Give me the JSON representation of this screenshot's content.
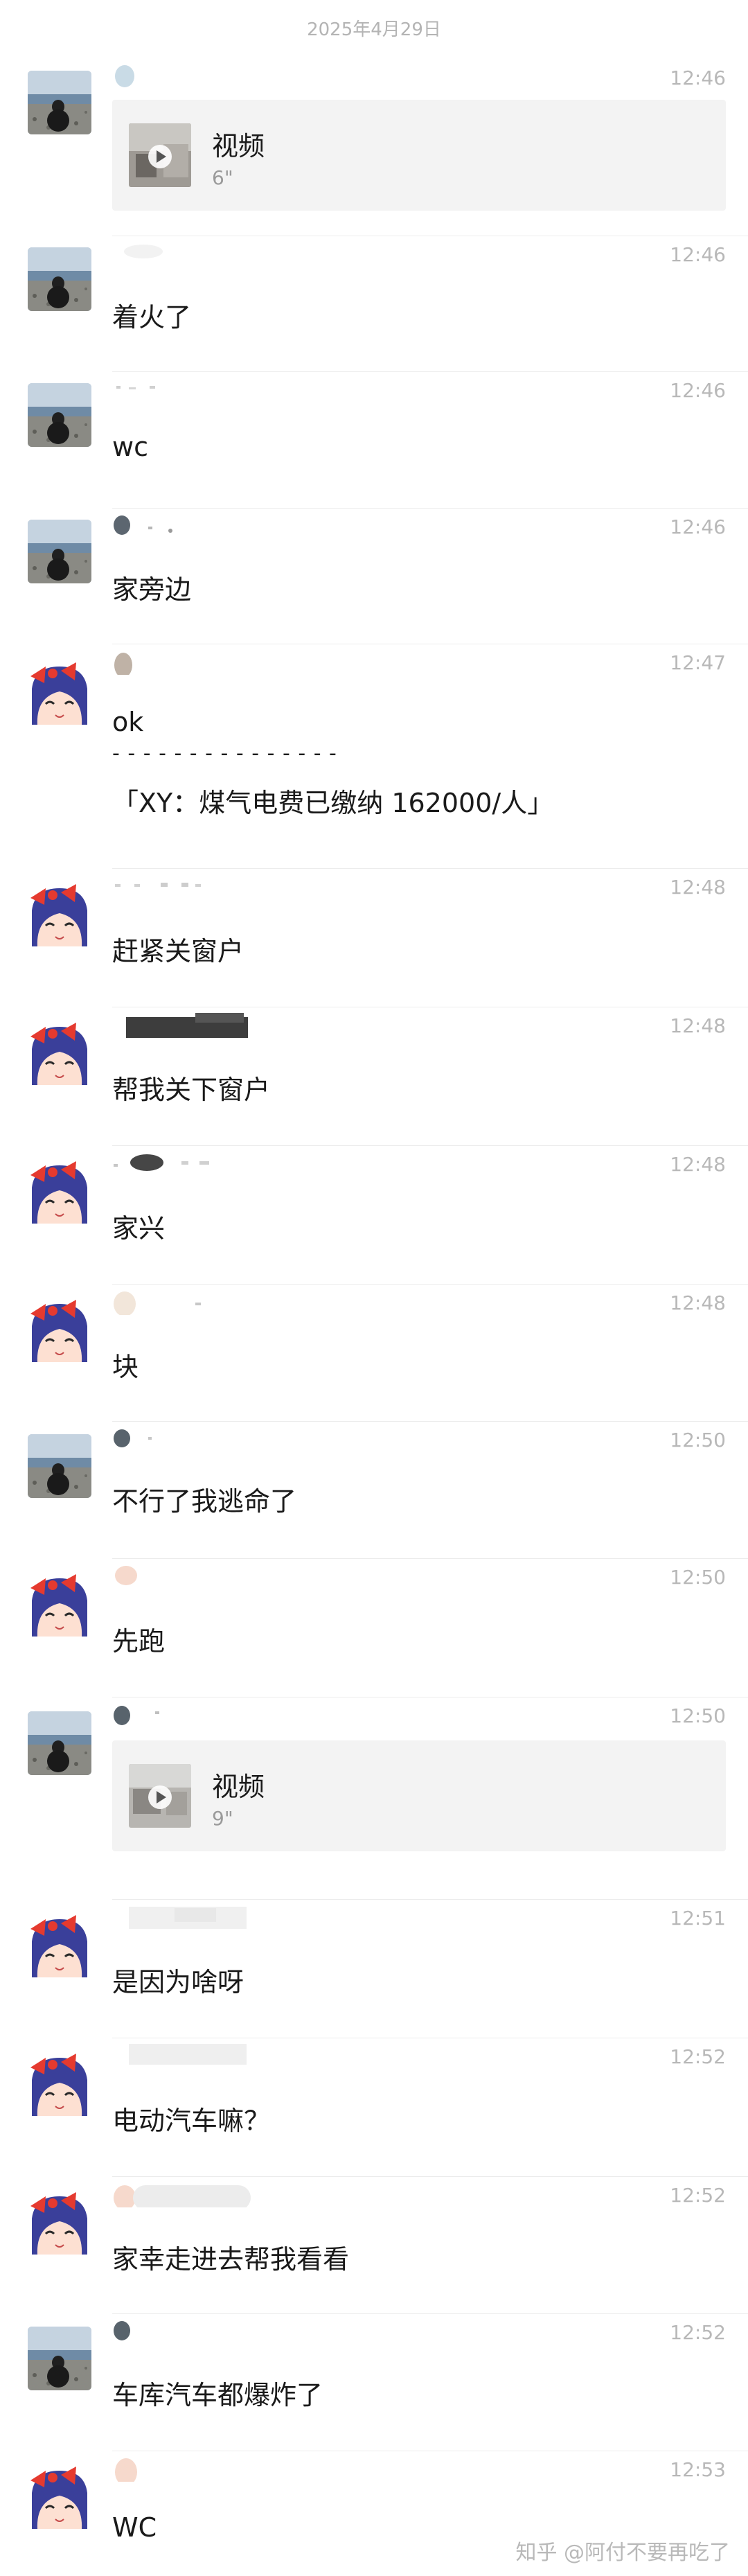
{
  "date_header": "2025年4月29日",
  "messages": [
    {
      "avatar": "beach",
      "time": "12:46",
      "type": "video",
      "video": {
        "title": "视频",
        "duration": "6\""
      }
    },
    {
      "avatar": "beach",
      "time": "12:46",
      "type": "text",
      "text": "着火了"
    },
    {
      "avatar": "beach",
      "time": "12:46",
      "type": "text",
      "text": "wc"
    },
    {
      "avatar": "beach",
      "time": "12:46",
      "type": "text",
      "text": "家旁边"
    },
    {
      "avatar": "anime",
      "time": "12:47",
      "type": "text",
      "text": "ok",
      "quote_divider": "- - - - - - - - - - - - - - -",
      "quote": "「XY：煤气电费已缴纳 162000/人」"
    },
    {
      "avatar": "anime",
      "time": "12:48",
      "type": "text",
      "text": "赶紧关窗户"
    },
    {
      "avatar": "anime",
      "time": "12:48",
      "type": "text",
      "text": "帮我关下窗户"
    },
    {
      "avatar": "anime",
      "time": "12:48",
      "type": "text",
      "text": "家兴"
    },
    {
      "avatar": "anime",
      "time": "12:48",
      "type": "text",
      "text": "块"
    },
    {
      "avatar": "beach",
      "time": "12:50",
      "type": "text",
      "text": "不行了我逃命了"
    },
    {
      "avatar": "anime",
      "time": "12:50",
      "type": "text",
      "text": "先跑"
    },
    {
      "avatar": "beach",
      "time": "12:50",
      "type": "video",
      "video": {
        "title": "视频",
        "duration": "9\""
      }
    },
    {
      "avatar": "anime",
      "time": "12:51",
      "type": "text",
      "text": "是因为啥呀"
    },
    {
      "avatar": "anime",
      "time": "12:52",
      "type": "text",
      "text": "电动汽车嘛？"
    },
    {
      "avatar": "anime",
      "time": "12:52",
      "type": "text",
      "text": "家幸走进去帮我看看"
    },
    {
      "avatar": "beach",
      "time": "12:52",
      "type": "text",
      "text": "车库汽车都爆炸了"
    },
    {
      "avatar": "anime",
      "time": "12:53",
      "type": "text",
      "text": "WC"
    }
  ],
  "watermark": "知乎 @阿付不要再吃了",
  "colors": {
    "background": "#ffffff",
    "time": "#b8b8b8",
    "card": "#f3f3f3",
    "separator": "#ececec"
  }
}
